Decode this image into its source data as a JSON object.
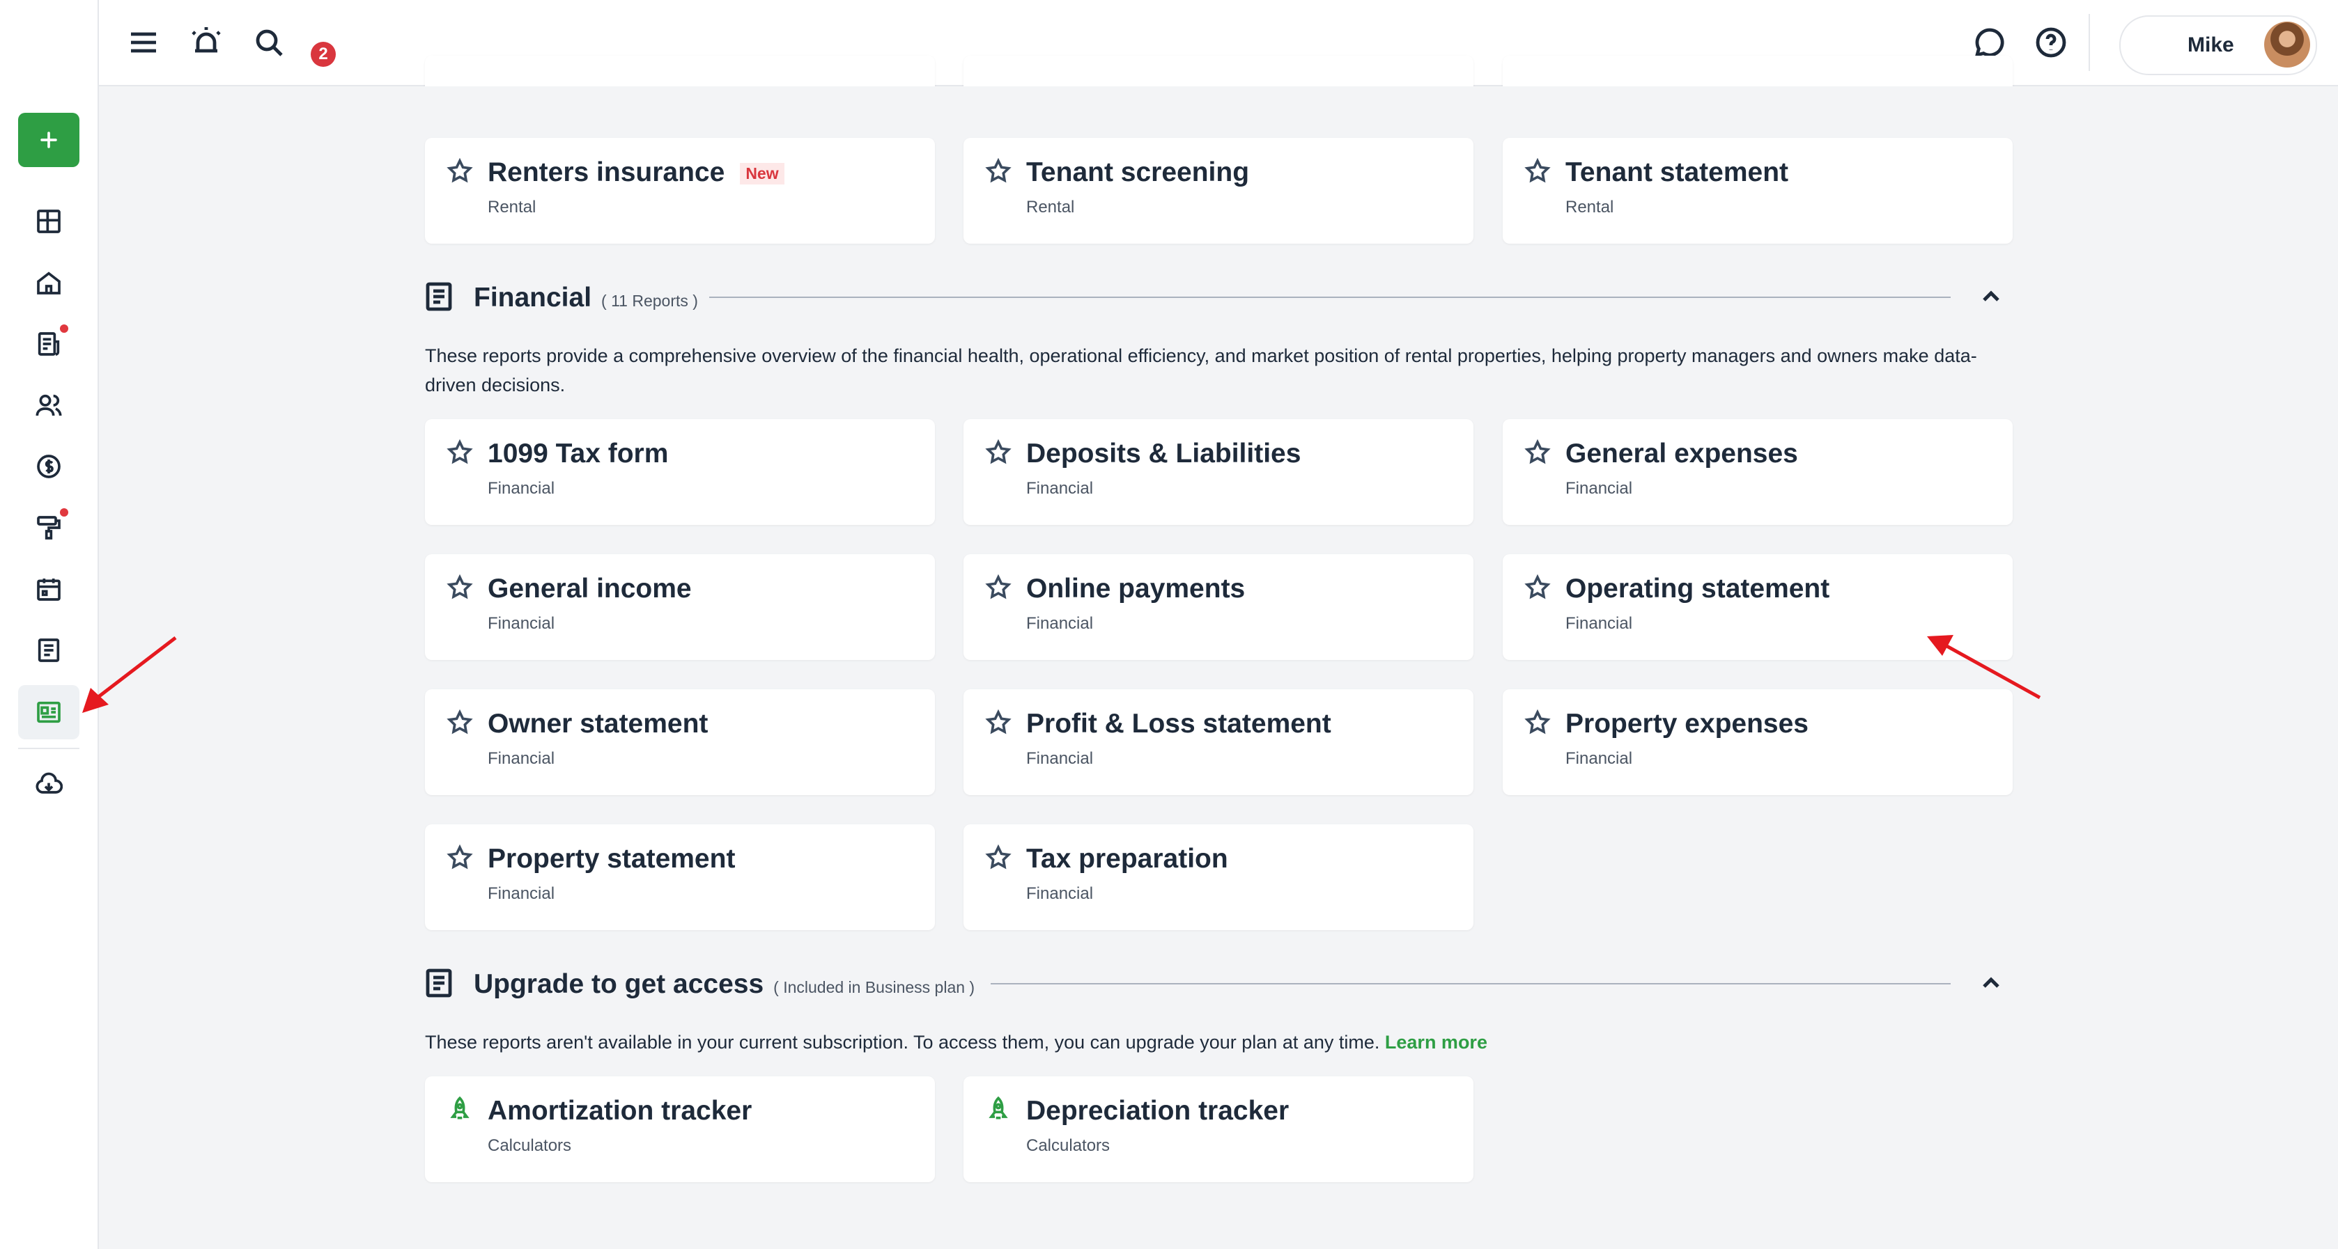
{
  "topbar": {
    "notification_count": "2",
    "user_name": "Mike"
  },
  "rental_cards": [
    {
      "title": "Renters insurance",
      "badge": "New",
      "category": "Rental"
    },
    {
      "title": "Tenant screening",
      "category": "Rental"
    },
    {
      "title": "Tenant statement",
      "category": "Rental"
    }
  ],
  "financial": {
    "title": "Financial",
    "count": "( 11 Reports )",
    "description": "These reports provide a comprehensive overview of the financial health, operational efficiency, and market position of rental properties, helping property managers and owners make data-driven decisions.",
    "cards": [
      {
        "title": "1099 Tax form",
        "category": "Financial"
      },
      {
        "title": "Deposits & Liabilities",
        "category": "Financial"
      },
      {
        "title": "General expenses",
        "category": "Financial"
      },
      {
        "title": "General income",
        "category": "Financial"
      },
      {
        "title": "Online payments",
        "category": "Financial"
      },
      {
        "title": "Operating statement",
        "category": "Financial"
      },
      {
        "title": "Owner statement",
        "category": "Financial"
      },
      {
        "title": "Profit & Loss statement",
        "category": "Financial"
      },
      {
        "title": "Property expenses",
        "category": "Financial"
      },
      {
        "title": "Property statement",
        "category": "Financial"
      },
      {
        "title": "Tax preparation",
        "category": "Financial"
      }
    ]
  },
  "upgrade": {
    "title": "Upgrade to get access",
    "note": "( Included in Business plan )",
    "description": "These reports aren't available in your current subscription. To access them, you can upgrade your plan at any time.",
    "learn_more": "Learn more",
    "cards": [
      {
        "title": "Amortization tracker",
        "category": "Calculators"
      },
      {
        "title": "Depreciation tracker",
        "category": "Calculators"
      }
    ]
  },
  "colors": {
    "accent": "#2e9e44",
    "alert": "#d9363e",
    "annotation_arrow": "#e5191f"
  },
  "icons": [
    "menu-icon",
    "alarm-icon",
    "search-icon",
    "chat-icon",
    "help-icon",
    "plus-icon",
    "dashboard-icon",
    "home-icon",
    "lease-icon",
    "people-icon",
    "dollar-icon",
    "maintenance-icon",
    "calendar-icon",
    "notes-icon",
    "reports-icon",
    "download-icon",
    "star-icon",
    "document-icon",
    "chevron-up-icon",
    "rocket-icon"
  ]
}
